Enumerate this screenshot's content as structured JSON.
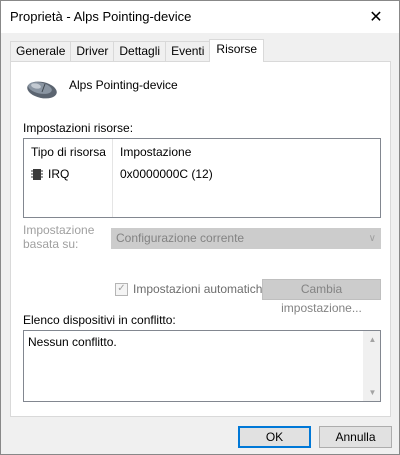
{
  "window": {
    "title": "Proprietà - Alps Pointing-device",
    "close_glyph": "✕"
  },
  "tabs": [
    {
      "label": "Generale"
    },
    {
      "label": "Driver"
    },
    {
      "label": "Dettagli"
    },
    {
      "label": "Eventi"
    },
    {
      "label": "Risorse",
      "active": true
    }
  ],
  "device": {
    "icon": "mouse-icon",
    "name": "Alps Pointing-device"
  },
  "resources": {
    "section_label": "Impostazioni risorse:",
    "columns": [
      "Tipo di risorsa",
      "Impostazione"
    ],
    "rows": [
      {
        "type": "IRQ",
        "icon": "chip-icon",
        "setting": "0x0000000C (12)"
      }
    ]
  },
  "based_on": {
    "label_line1": "Impostazione",
    "label_line2": "basata su:",
    "value": "Configurazione corrente",
    "arrow": "∨"
  },
  "auto_settings": {
    "label": "Impostazioni automatiche",
    "checked": true,
    "check_glyph": "✓"
  },
  "change_setting_button": "Cambia impostazione...",
  "conflicts": {
    "label": "Elenco dispositivi in conflitto:",
    "text": "Nessun conflitto.",
    "scroll_up": "▲",
    "scroll_down": "▼"
  },
  "footer": {
    "ok_label": "OK",
    "cancel_label": "Annulla"
  },
  "colors": {
    "accent": "#0078d7",
    "disabled_text": "#838383"
  }
}
